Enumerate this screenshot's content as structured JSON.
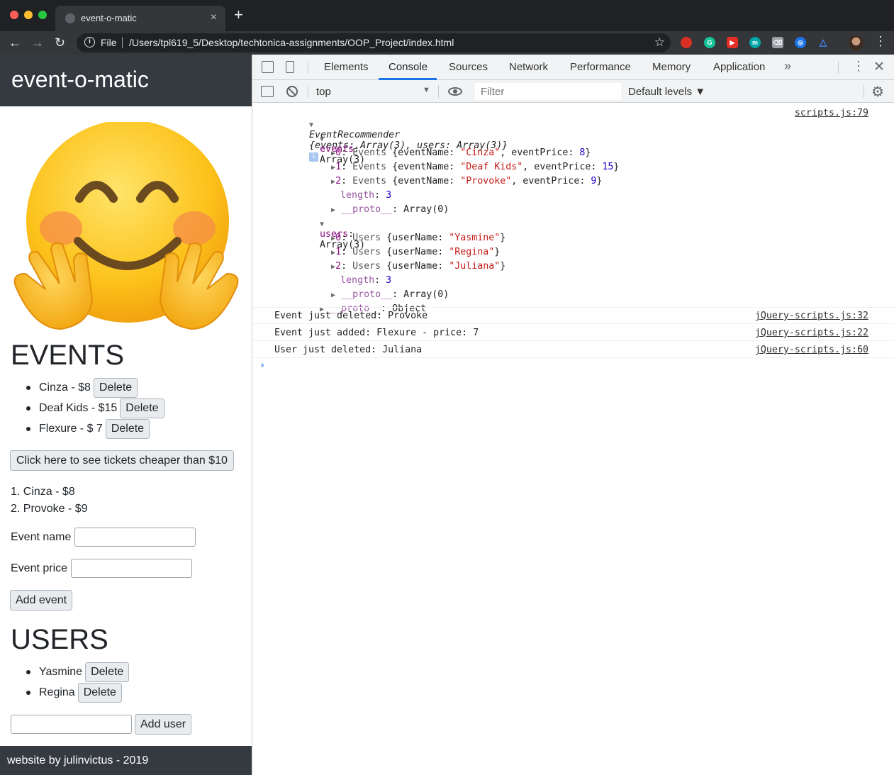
{
  "browser": {
    "tab_title": "event-o-matic",
    "tab_close": "×",
    "new_tab": "+",
    "url_scheme": "File",
    "url": "/Users/tpl619_5/Desktop/techtonica-assignments/OOP_Project/index.html",
    "back": "←",
    "forward": "→",
    "reload": "↻",
    "star": "☆",
    "menu": "⋮"
  },
  "page": {
    "header_title": "event-o-matic",
    "events_heading": "EVENTS",
    "events": [
      {
        "label": "Cinza - $8",
        "delete": "Delete"
      },
      {
        "label": "Deaf Kids - $15",
        "delete": "Delete"
      },
      {
        "label": "Flexure - $ 7",
        "delete": "Delete"
      }
    ],
    "cheap_button": "Click here to see tickets cheaper than $10",
    "cheap_results": [
      "1. Cinza - $8",
      "2. Provoke - $9"
    ],
    "event_name_label": "Event name",
    "event_price_label": "Event price",
    "add_event_button": "Add event",
    "users_heading": "USERS",
    "users": [
      {
        "label": "Yasmine",
        "delete": "Delete"
      },
      {
        "label": "Regina",
        "delete": "Delete"
      }
    ],
    "add_user_button": "Add user",
    "footer": "website by julinvictus - 2019"
  },
  "devtools": {
    "tabs": [
      "Elements",
      "Console",
      "Sources",
      "Network",
      "Performance",
      "Memory",
      "Application"
    ],
    "active_tab": "Console",
    "more": "»",
    "kebab": "⋮",
    "close": "✕",
    "context": "top",
    "filter_placeholder": "Filter",
    "levels": "Default levels ▼",
    "gear": "⚙",
    "console": {
      "obj_class": "EventRecommender",
      "obj_summary": "{events: Array(3), users: Array(3)}",
      "obj_source": "scripts.js:79",
      "events_key": "events",
      "events_type": "Array(3)",
      "events": [
        {
          "idx": "0",
          "cls": "Events",
          "name": "\"Cinza\"",
          "price": "8"
        },
        {
          "idx": "1",
          "cls": "Events",
          "name": "\"Deaf Kids\"",
          "price": "15"
        },
        {
          "idx": "2",
          "cls": "Events",
          "name": "\"Provoke\"",
          "price": "9"
        }
      ],
      "users_key": "users",
      "users_type": "Array(3)",
      "users": [
        {
          "idx": "0",
          "cls": "Users",
          "name": "\"Yasmine\""
        },
        {
          "idx": "1",
          "cls": "Users",
          "name": "\"Regina\""
        },
        {
          "idx": "2",
          "cls": "Users",
          "name": "\"Juliana\""
        }
      ],
      "length_key": "length",
      "length_val": "3",
      "proto_key": "__proto__",
      "proto_array": "Array(0)",
      "proto_object": "Object",
      "logs": [
        {
          "text": "Event just deleted: Provoke",
          "source": "jQuery-scripts.js:32"
        },
        {
          "text": "Event just added: Flexure - price: 7",
          "source": "jQuery-scripts.js:22"
        },
        {
          "text": "User just deleted: Juliana",
          "source": "jQuery-scripts.js:60"
        }
      ],
      "prompt": "›"
    }
  },
  "colors": {
    "chrome_dark": "#202124",
    "chrome_toolbar": "#35363a",
    "page_header": "#343a40",
    "devtools_accent": "#1a73e8"
  }
}
